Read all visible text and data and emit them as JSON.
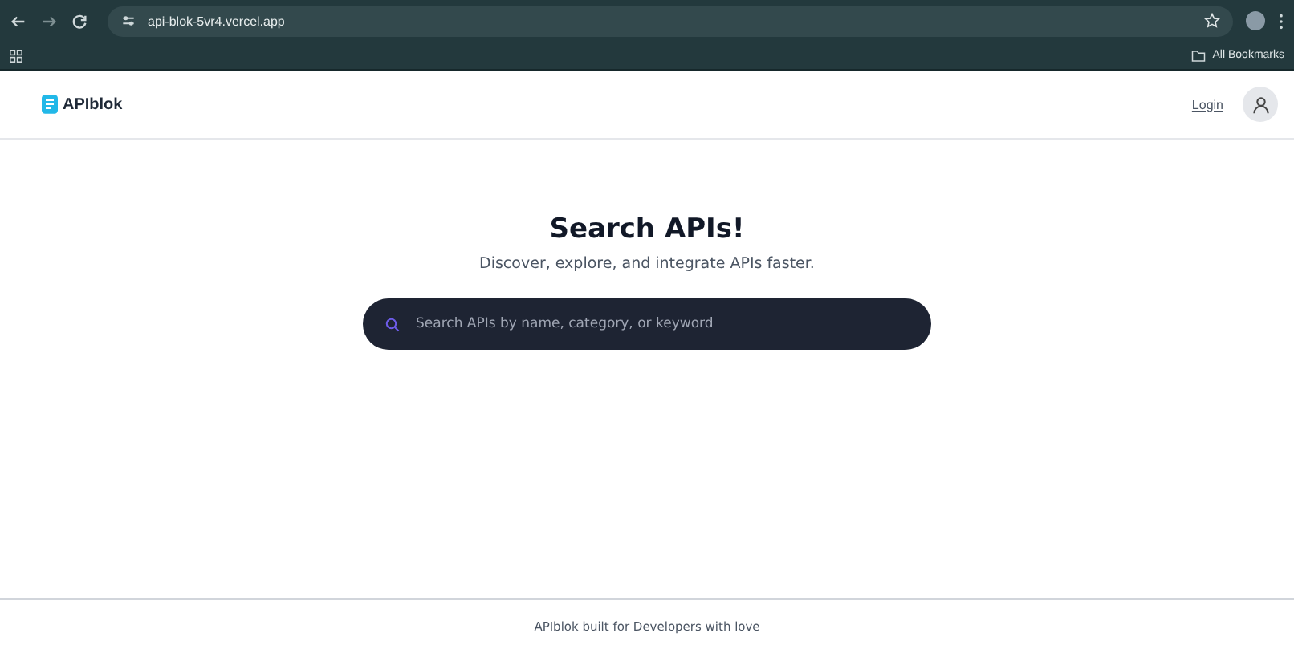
{
  "browser": {
    "url": "api-blok-5vr4.vercel.app",
    "bookmarks_label": "All Bookmarks"
  },
  "header": {
    "brand": "APIblok",
    "login": "Login"
  },
  "hero": {
    "title": "Search APIs!",
    "subtitle": "Discover, explore, and integrate APIs faster.",
    "search": {
      "placeholder": "Search APIs by name, category, or keyword"
    }
  },
  "footer": {
    "text": "APIblok built for Developers with love"
  }
}
